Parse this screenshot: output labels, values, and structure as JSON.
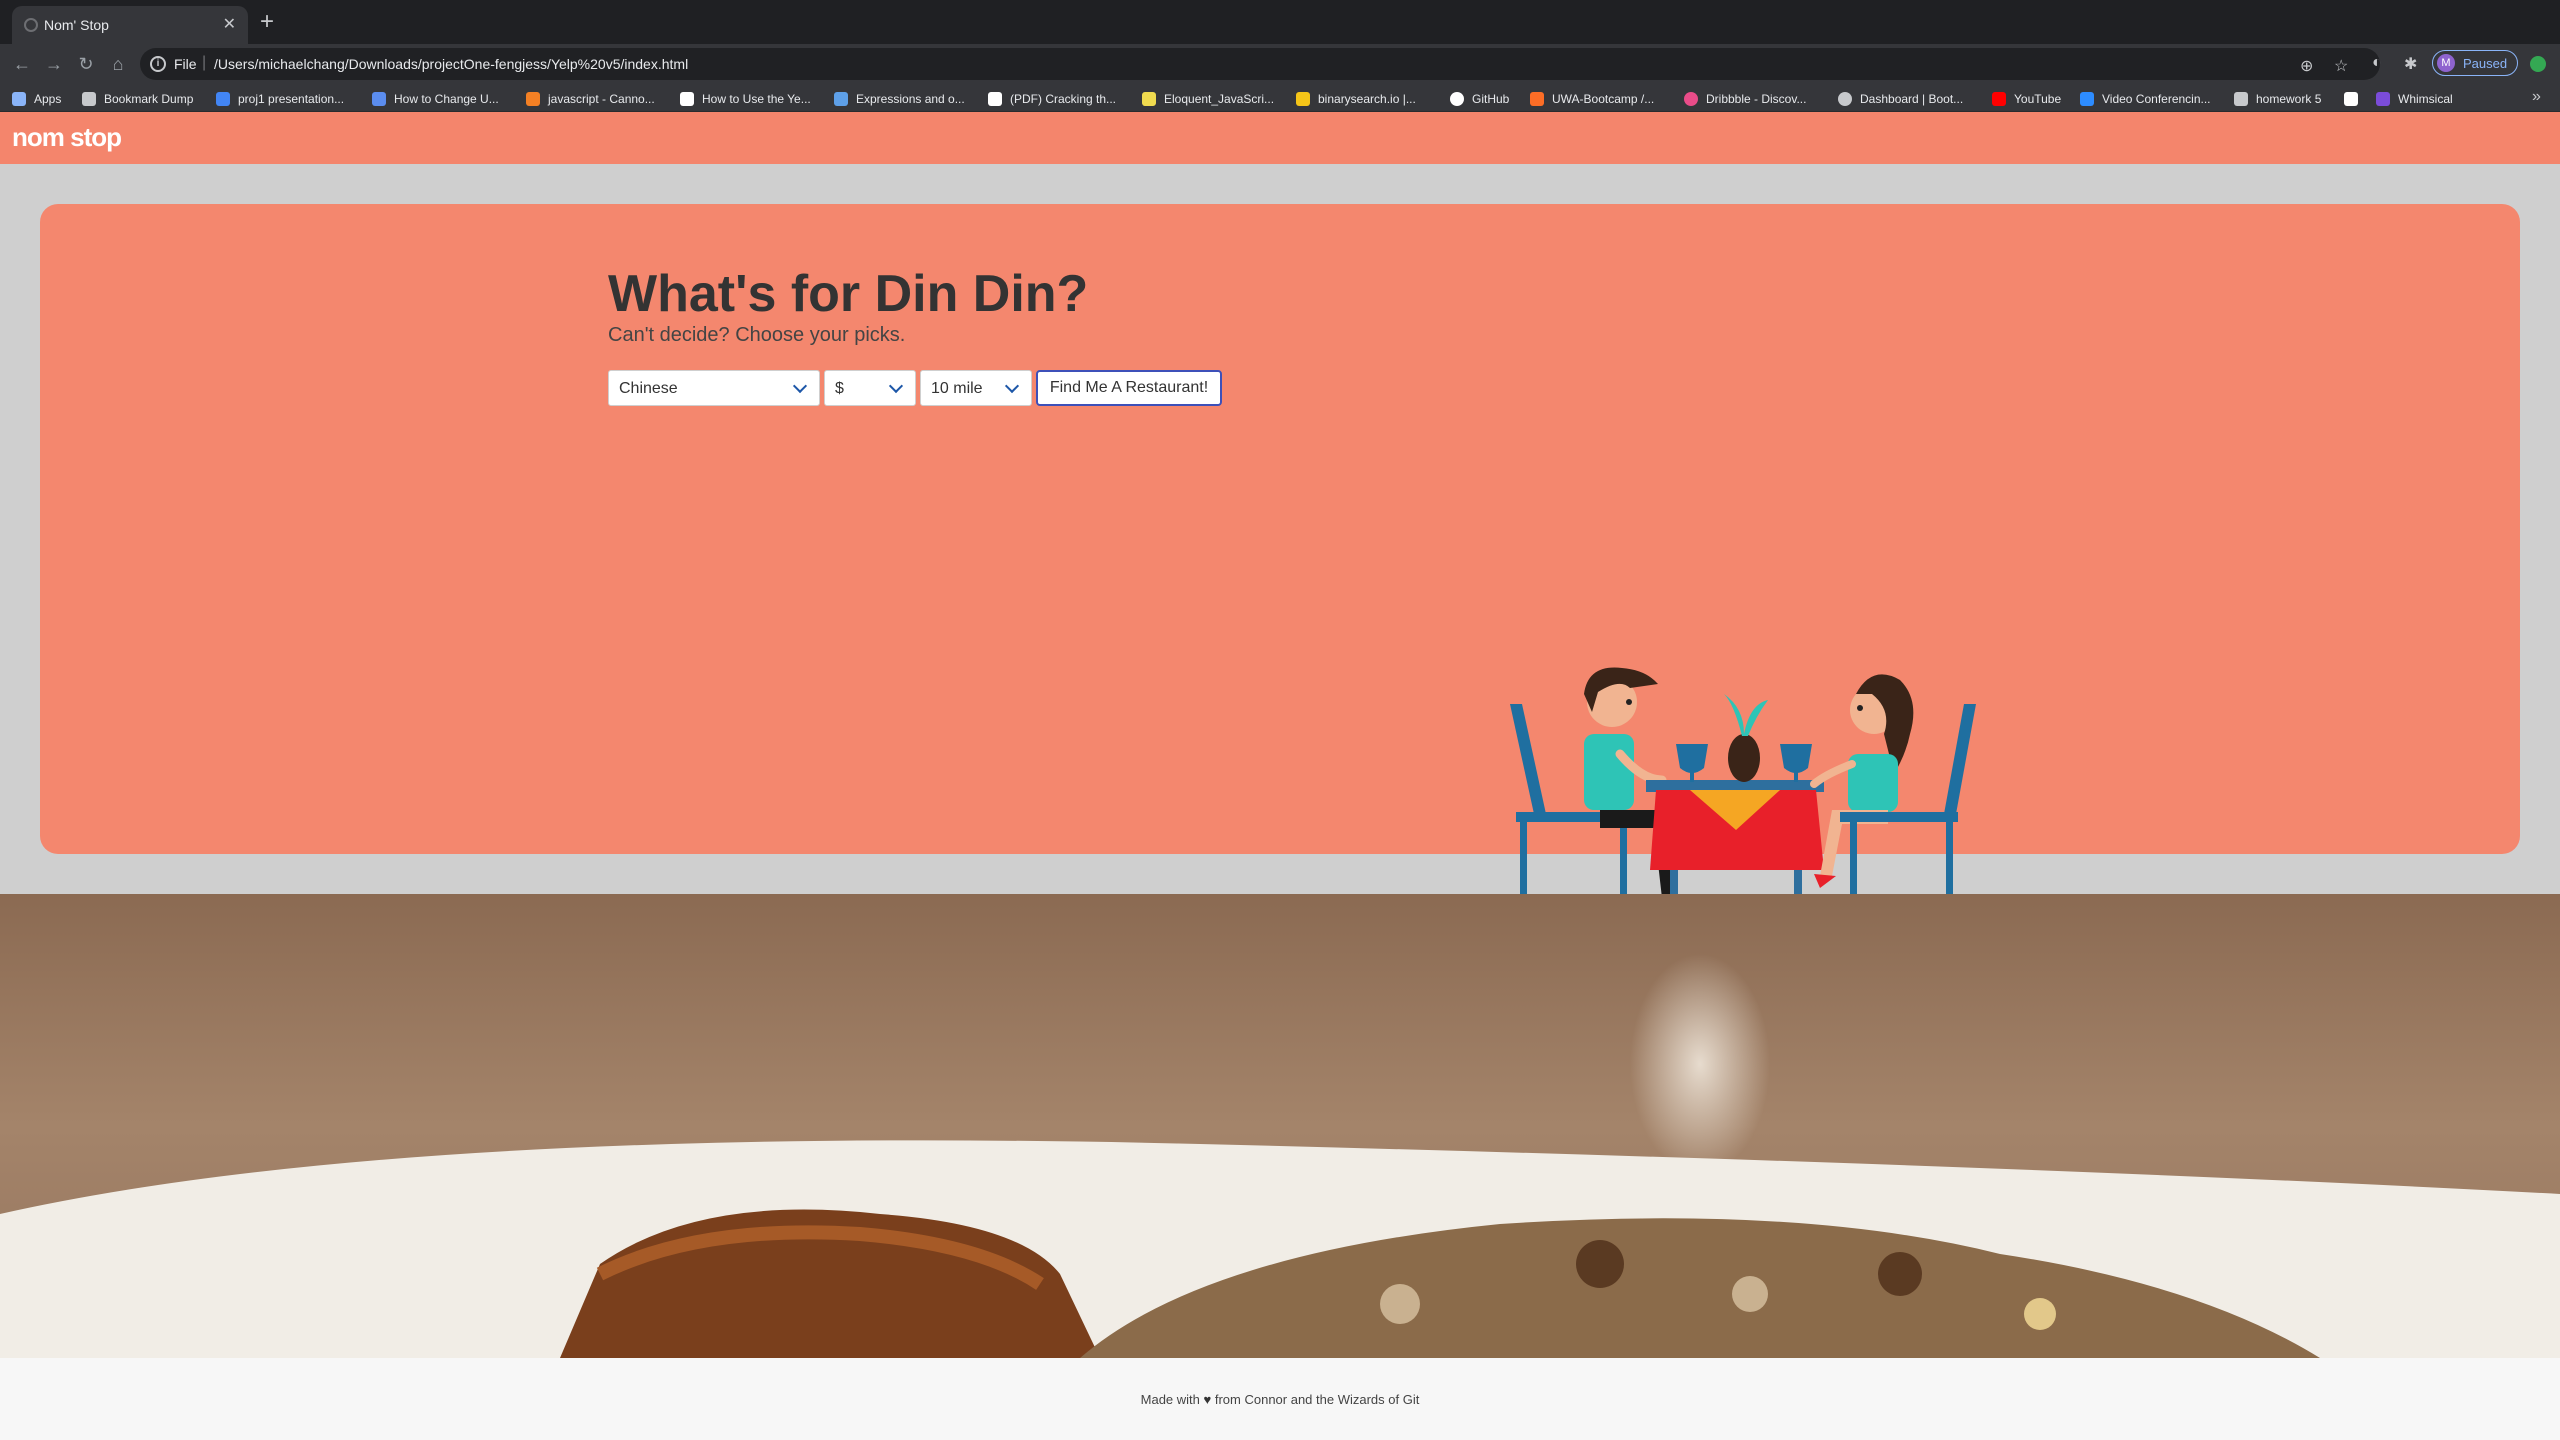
{
  "browser": {
    "tab_title": "Nom' Stop",
    "url_scheme": "File",
    "url": "/Users/michaelchang/Downloads/projectOne-fengjess/Yelp%20v5/index.html",
    "profile_initial": "M",
    "profile_status": "Paused",
    "bookmarks": [
      {
        "label": "Apps",
        "icon": "apps-grid-icon",
        "color": "#8ab4f8"
      },
      {
        "label": "Bookmark Dump",
        "icon": "folder-icon",
        "color": "#c7c9cc"
      },
      {
        "label": "proj1 presentation...",
        "icon": "docs-icon",
        "color": "#4285f4"
      },
      {
        "label": "How to Change U...",
        "icon": "page-icon",
        "color": "#5b8def"
      },
      {
        "label": "javascript - Canno...",
        "icon": "stackoverflow-icon",
        "color": "#f48024"
      },
      {
        "label": "How to Use the Ye...",
        "icon": "medium-icon",
        "color": "#ffffff"
      },
      {
        "label": "Expressions and o...",
        "icon": "page-icon",
        "color": "#5ea0e8"
      },
      {
        "label": "(PDF) Cracking th...",
        "icon": "pdf-icon",
        "color": "#ffffff"
      },
      {
        "label": "Eloquent_JavaScri...",
        "icon": "js-icon",
        "color": "#f0db4f"
      },
      {
        "label": "binarysearch.io |...",
        "icon": "page-icon",
        "color": "#f5c518"
      },
      {
        "label": "GitHub",
        "icon": "github-icon",
        "color": "#ffffff"
      },
      {
        "label": "UWA-Bootcamp /...",
        "icon": "gitlab-icon",
        "color": "#fc6d26"
      },
      {
        "label": "Dribbble - Discov...",
        "icon": "dribbble-icon",
        "color": "#ea4c89"
      },
      {
        "label": "Dashboard | Boot...",
        "icon": "page-icon",
        "color": "#c7c9cc"
      },
      {
        "label": "YouTube",
        "icon": "youtube-icon",
        "color": "#ff0000"
      },
      {
        "label": "Video Conferencin...",
        "icon": "zoom-icon",
        "color": "#2d8cff"
      },
      {
        "label": "homework 5",
        "icon": "folder-icon",
        "color": "#c7c9cc"
      },
      {
        "label": "",
        "icon": "page-icon",
        "color": "#ffffff"
      },
      {
        "label": "Whimsical",
        "icon": "whimsical-icon",
        "color": "#7b4cd9"
      }
    ]
  },
  "navbar": {
    "brand": "nom stop"
  },
  "hero": {
    "title": "What's for Din Din?",
    "lead": "Can't decide? Choose your picks.",
    "cuisine_value": "Chinese",
    "price_value": "$",
    "distance_value": "10 mile",
    "submit_label": "Find Me A Restaurant!"
  },
  "footer": {
    "prefix": "Made with",
    "suffix": "from Connor and the Wizards of Git"
  }
}
